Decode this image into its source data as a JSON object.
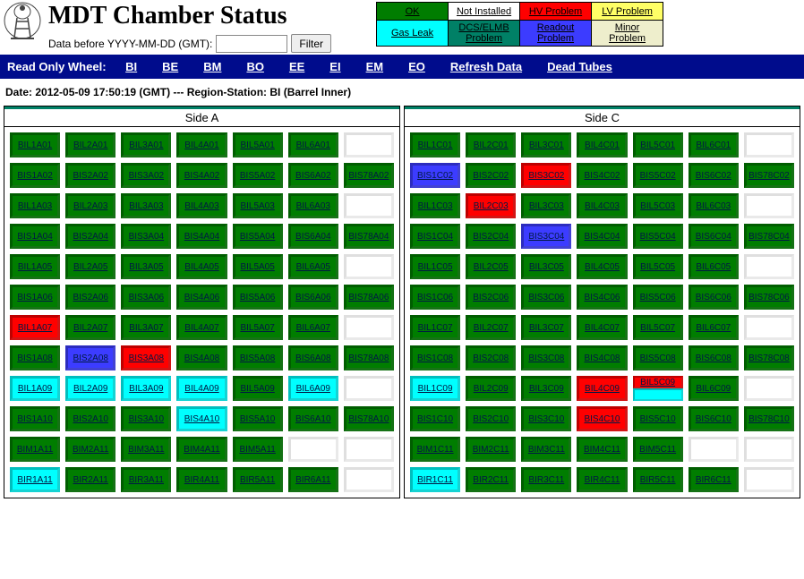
{
  "header": {
    "title": "MDT Chamber Status",
    "filter_label": "Data before YYYY-MM-DD (GMT):",
    "filter_value": "",
    "filter_button": "Filter"
  },
  "legend": {
    "rows": [
      [
        {
          "label": "OK",
          "bg": "#007d00",
          "fg": "#000"
        },
        {
          "label": "Not Installed",
          "bg": "#ffffff",
          "fg": "#000"
        },
        {
          "label": "HV Problem",
          "bg": "#ff0000",
          "fg": "#000"
        },
        {
          "label": "LV Problem",
          "bg": "#ffff66",
          "fg": "#000"
        }
      ],
      [
        {
          "label": "Gas Leak",
          "bg": "#00ffff",
          "fg": "#000"
        },
        {
          "label": "DCS/ELMB Problem",
          "bg": "#008066",
          "fg": "#000"
        },
        {
          "label": "Readout Problem",
          "bg": "#3c3cff",
          "fg": "#000"
        },
        {
          "label": "Minor Problem",
          "bg": "#eeeecc",
          "fg": "#000"
        }
      ]
    ]
  },
  "nav": {
    "prefix": "Read Only Wheel:",
    "links": [
      "BI",
      "BE",
      "BM",
      "BO",
      "EE",
      "EI",
      "EM",
      "EO",
      "Refresh Data",
      "Dead Tubes"
    ]
  },
  "dateline": "Date: 2012-05-09 17:50:19 (GMT) --- Region-Station: BI (Barrel Inner)",
  "sides": [
    {
      "title": "Side A",
      "rows": [
        [
          {
            "t": "BIL1A01",
            "c": "green"
          },
          {
            "t": "BIL2A01",
            "c": "green"
          },
          {
            "t": "BIL3A01",
            "c": "green"
          },
          {
            "t": "BIL4A01",
            "c": "green"
          },
          {
            "t": "BIL5A01",
            "c": "green"
          },
          {
            "t": "BIL6A01",
            "c": "green"
          },
          null
        ],
        [
          {
            "t": "BIS1A02",
            "c": "green"
          },
          {
            "t": "BIS2A02",
            "c": "green"
          },
          {
            "t": "BIS3A02",
            "c": "green"
          },
          {
            "t": "BIS4A02",
            "c": "green"
          },
          {
            "t": "BIS5A02",
            "c": "green"
          },
          {
            "t": "BIS6A02",
            "c": "green"
          },
          {
            "t": "BIS78A02",
            "c": "green"
          }
        ],
        [
          {
            "t": "BIL1A03",
            "c": "green"
          },
          {
            "t": "BIL2A03",
            "c": "green"
          },
          {
            "t": "BIL3A03",
            "c": "green"
          },
          {
            "t": "BIL4A03",
            "c": "green"
          },
          {
            "t": "BIL5A03",
            "c": "green"
          },
          {
            "t": "BIL6A03",
            "c": "green"
          },
          null
        ],
        [
          {
            "t": "BIS1A04",
            "c": "green"
          },
          {
            "t": "BIS2A04",
            "c": "green"
          },
          {
            "t": "BIS3A04",
            "c": "green"
          },
          {
            "t": "BIS4A04",
            "c": "green"
          },
          {
            "t": "BIS5A04",
            "c": "green"
          },
          {
            "t": "BIS6A04",
            "c": "green"
          },
          {
            "t": "BIS78A04",
            "c": "green"
          }
        ],
        [
          {
            "t": "BIL1A05",
            "c": "green"
          },
          {
            "t": "BIL2A05",
            "c": "green"
          },
          {
            "t": "BIL3A05",
            "c": "green"
          },
          {
            "t": "BIL4A05",
            "c": "green"
          },
          {
            "t": "BIL5A05",
            "c": "green"
          },
          {
            "t": "BIL6A05",
            "c": "green"
          },
          null
        ],
        [
          {
            "t": "BIS1A06",
            "c": "green"
          },
          {
            "t": "BIS2A06",
            "c": "green"
          },
          {
            "t": "BIS3A06",
            "c": "green"
          },
          {
            "t": "BIS4A06",
            "c": "green"
          },
          {
            "t": "BIS5A06",
            "c": "green"
          },
          {
            "t": "BIS6A06",
            "c": "green"
          },
          {
            "t": "BIS78A06",
            "c": "green"
          }
        ],
        [
          {
            "t": "BIL1A07",
            "c": "red"
          },
          {
            "t": "BIL2A07",
            "c": "green"
          },
          {
            "t": "BIL3A07",
            "c": "green"
          },
          {
            "t": "BIL4A07",
            "c": "green"
          },
          {
            "t": "BIL5A07",
            "c": "green"
          },
          {
            "t": "BIL6A07",
            "c": "green"
          },
          null
        ],
        [
          {
            "t": "BIS1A08",
            "c": "green"
          },
          {
            "t": "BIS2A08",
            "c": "blue"
          },
          {
            "t": "BIS3A08",
            "c": "red"
          },
          {
            "t": "BIS4A08",
            "c": "green"
          },
          {
            "t": "BIS5A08",
            "c": "green"
          },
          {
            "t": "BIS6A08",
            "c": "green"
          },
          {
            "t": "BIS78A08",
            "c": "green"
          }
        ],
        [
          {
            "t": "BIL1A09",
            "c": "cyan"
          },
          {
            "t": "BIL2A09",
            "c": "cyan"
          },
          {
            "t": "BIL3A09",
            "c": "cyan"
          },
          {
            "t": "BIL4A09",
            "c": "cyan"
          },
          {
            "t": "BIL5A09",
            "c": "green"
          },
          {
            "t": "BIL6A09",
            "c": "cyan"
          },
          null
        ],
        [
          {
            "t": "BIS1A10",
            "c": "green"
          },
          {
            "t": "BIS2A10",
            "c": "green"
          },
          {
            "t": "BIS3A10",
            "c": "green"
          },
          {
            "t": "BIS4A10",
            "c": "cyan"
          },
          {
            "t": "BIS5A10",
            "c": "green"
          },
          {
            "t": "BIS6A10",
            "c": "green"
          },
          {
            "t": "BIS78A10",
            "c": "green"
          }
        ],
        [
          {
            "t": "BIM1A11",
            "c": "green"
          },
          {
            "t": "BIM2A11",
            "c": "green"
          },
          {
            "t": "BIM3A11",
            "c": "green"
          },
          {
            "t": "BIM4A11",
            "c": "green"
          },
          {
            "t": "BIM5A11",
            "c": "green"
          },
          null,
          null
        ],
        [
          {
            "t": "BIR1A11",
            "c": "cyan"
          },
          {
            "t": "BIR2A11",
            "c": "green"
          },
          {
            "t": "BIR3A11",
            "c": "green"
          },
          {
            "t": "BIR4A11",
            "c": "green"
          },
          {
            "t": "BIR5A11",
            "c": "green"
          },
          {
            "t": "BIR6A11",
            "c": "green"
          },
          null
        ]
      ]
    },
    {
      "title": "Side C",
      "rows": [
        [
          {
            "t": "BIL1C01",
            "c": "green"
          },
          {
            "t": "BIL2C01",
            "c": "green"
          },
          {
            "t": "BIL3C01",
            "c": "green"
          },
          {
            "t": "BIL4C01",
            "c": "green"
          },
          {
            "t": "BIL5C01",
            "c": "green"
          },
          {
            "t": "BIL6C01",
            "c": "green"
          },
          null
        ],
        [
          {
            "t": "BIS1C02",
            "c": "blue"
          },
          {
            "t": "BIS2C02",
            "c": "green"
          },
          {
            "t": "BIS3C02",
            "c": "red"
          },
          {
            "t": "BIS4C02",
            "c": "green"
          },
          {
            "t": "BIS5C02",
            "c": "green"
          },
          {
            "t": "BIS6C02",
            "c": "green"
          },
          {
            "t": "BIS78C02",
            "c": "green"
          }
        ],
        [
          {
            "t": "BIL1C03",
            "c": "green"
          },
          {
            "t": "BIL2C03",
            "c": "red"
          },
          {
            "t": "BIL3C03",
            "c": "green"
          },
          {
            "t": "BIL4C03",
            "c": "green"
          },
          {
            "t": "BIL5C03",
            "c": "green"
          },
          {
            "t": "BIL6C03",
            "c": "green"
          },
          null
        ],
        [
          {
            "t": "BIS1C04",
            "c": "green"
          },
          {
            "t": "BIS2C04",
            "c": "green"
          },
          {
            "t": "BIS3C04",
            "c": "blue"
          },
          {
            "t": "BIS4C04",
            "c": "green"
          },
          {
            "t": "BIS5C04",
            "c": "green"
          },
          {
            "t": "BIS6C04",
            "c": "green"
          },
          {
            "t": "BIS78C04",
            "c": "green"
          }
        ],
        [
          {
            "t": "BIL1C05",
            "c": "green"
          },
          {
            "t": "BIL2C05",
            "c": "green"
          },
          {
            "t": "BIL3C05",
            "c": "green"
          },
          {
            "t": "BIL4C05",
            "c": "green"
          },
          {
            "t": "BIL5C05",
            "c": "green"
          },
          {
            "t": "BIL6C05",
            "c": "green"
          },
          null
        ],
        [
          {
            "t": "BIS1C06",
            "c": "green"
          },
          {
            "t": "BIS2C06",
            "c": "green"
          },
          {
            "t": "BIS3C06",
            "c": "green"
          },
          {
            "t": "BIS4C06",
            "c": "green"
          },
          {
            "t": "BIS5C06",
            "c": "green"
          },
          {
            "t": "BIS6C06",
            "c": "green"
          },
          {
            "t": "BIS78C06",
            "c": "green"
          }
        ],
        [
          {
            "t": "BIL1C07",
            "c": "green"
          },
          {
            "t": "BIL2C07",
            "c": "green"
          },
          {
            "t": "BIL3C07",
            "c": "green"
          },
          {
            "t": "BIL4C07",
            "c": "green"
          },
          {
            "t": "BIL5C07",
            "c": "green"
          },
          {
            "t": "BIL6C07",
            "c": "green"
          },
          null
        ],
        [
          {
            "t": "BIS1C08",
            "c": "green"
          },
          {
            "t": "BIS2C08",
            "c": "green"
          },
          {
            "t": "BIS3C08",
            "c": "green"
          },
          {
            "t": "BIS4C08",
            "c": "green"
          },
          {
            "t": "BIS5C08",
            "c": "green"
          },
          {
            "t": "BIS6C08",
            "c": "green"
          },
          {
            "t": "BIS78C08",
            "c": "green"
          }
        ],
        [
          {
            "t": "BIL1C09",
            "c": "cyan"
          },
          {
            "t": "BIL2C09",
            "c": "green"
          },
          {
            "t": "BIL3C09",
            "c": "green"
          },
          {
            "t": "BIL4C09",
            "c": "red"
          },
          {
            "t": "BIL5C09",
            "c": "red",
            "bot": "cyan"
          },
          {
            "t": "BIL6C09",
            "c": "green"
          },
          null
        ],
        [
          {
            "t": "BIS1C10",
            "c": "green"
          },
          {
            "t": "BIS2C10",
            "c": "green"
          },
          {
            "t": "BIS3C10",
            "c": "green"
          },
          {
            "t": "BIS4C10",
            "c": "red"
          },
          {
            "t": "BIS5C10",
            "c": "green"
          },
          {
            "t": "BIS6C10",
            "c": "green"
          },
          {
            "t": "BIS78C10",
            "c": "green"
          }
        ],
        [
          {
            "t": "BIM1C11",
            "c": "green"
          },
          {
            "t": "BIM2C11",
            "c": "green"
          },
          {
            "t": "BIM3C11",
            "c": "green"
          },
          {
            "t": "BIM4C11",
            "c": "green"
          },
          {
            "t": "BIM5C11",
            "c": "green"
          },
          null,
          null
        ],
        [
          {
            "t": "BIR1C11",
            "c": "cyan"
          },
          {
            "t": "BIR2C11",
            "c": "green"
          },
          {
            "t": "BIR3C11",
            "c": "green"
          },
          {
            "t": "BIR4C11",
            "c": "green"
          },
          {
            "t": "BIR5C11",
            "c": "green"
          },
          {
            "t": "BIR6C11",
            "c": "green"
          },
          null
        ]
      ]
    }
  ]
}
